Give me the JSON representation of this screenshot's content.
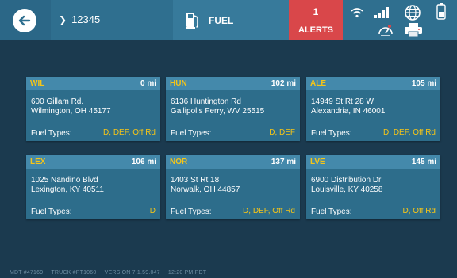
{
  "header": {
    "truck_number": "12345",
    "fuel_tab_label": "FUEL",
    "alerts_count": "1",
    "alerts_label": "ALERTS"
  },
  "stops": [
    {
      "code": "WIL",
      "distance": "0 mi",
      "address_line1": "600 Gillam Rd.",
      "address_line2": "Wilmington, OH 45177",
      "fuel_label": "Fuel Types:",
      "fuel_types": "D, DEF, Off Rd"
    },
    {
      "code": "HUN",
      "distance": "102 mi",
      "address_line1": "6136 Huntington Rd",
      "address_line2": "Gallipolis Ferry, WV 25515",
      "fuel_label": "Fuel Types:",
      "fuel_types": "D, DEF"
    },
    {
      "code": "ALE",
      "distance": "105 mi",
      "address_line1": "14949 St Rt 28 W",
      "address_line2": "Alexandria, IN 46001",
      "fuel_label": "Fuel Types:",
      "fuel_types": "D, DEF, Off Rd"
    },
    {
      "code": "LEX",
      "distance": "106 mi",
      "address_line1": "1025 Nandino Blvd",
      "address_line2": "Lexington, KY 40511",
      "fuel_label": "Fuel Types:",
      "fuel_types": "D"
    },
    {
      "code": "NOR",
      "distance": "137 mi",
      "address_line1": "1403 St Rt 18",
      "address_line2": "Norwalk, OH 44857",
      "fuel_label": "Fuel Types:",
      "fuel_types": "D, DEF, Off Rd"
    },
    {
      "code": "LVE",
      "distance": "145 mi",
      "address_line1": "6900 Distribution Dr",
      "address_line2": "Louisville, KY 40258",
      "fuel_label": "Fuel Types:",
      "fuel_types": "D, Off Rd"
    }
  ],
  "footer": {
    "mdt": "MDT #47169",
    "truck": "TRUCK #PT1060",
    "version": "VERSION  7.1.59.047",
    "time": "12:20 PM PDT"
  },
  "colors": {
    "background": "#1b3a4f",
    "header": "#2f6f8f",
    "card": "#2d6d8b",
    "card_header": "#4489ab",
    "accent_yellow": "#f5c518",
    "alert_red": "#d9474a"
  },
  "icons": [
    "back-arrow-icon",
    "chevron-right-icon",
    "fuel-pump-icon",
    "wifi-icon",
    "signal-bars-icon",
    "globe-icon",
    "battery-phone-icon",
    "gauge-icon",
    "printer-icon"
  ]
}
